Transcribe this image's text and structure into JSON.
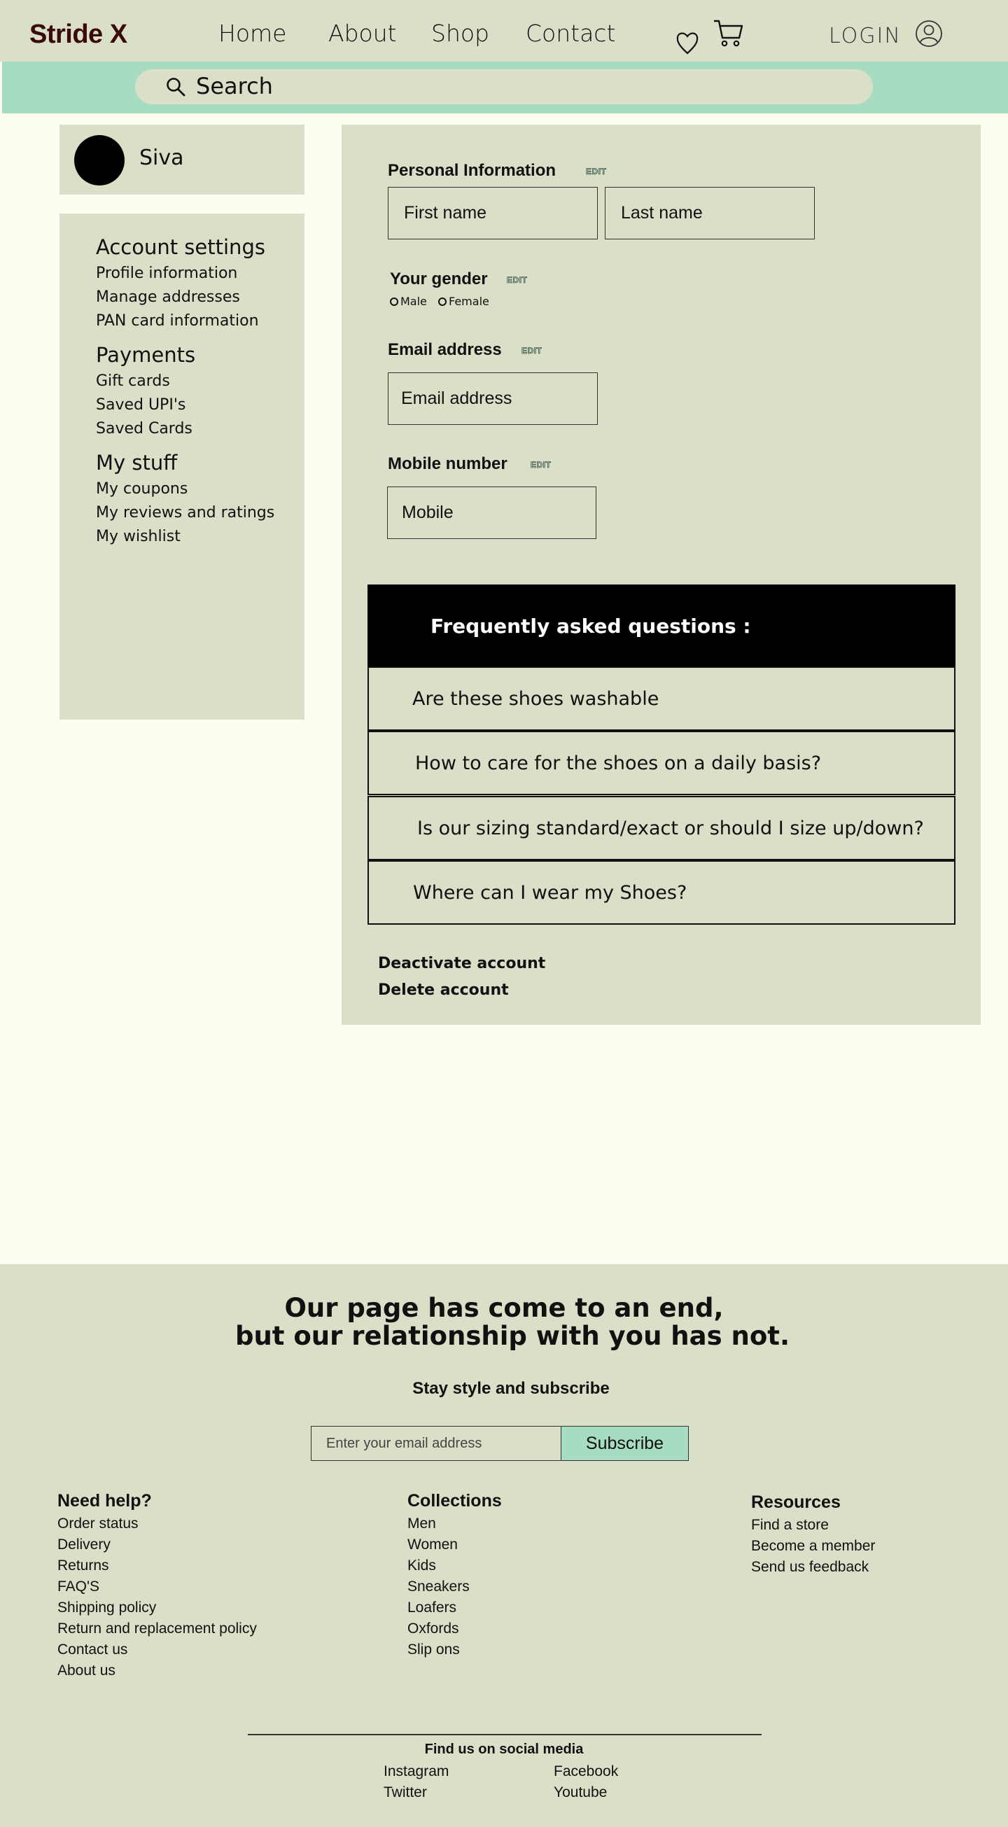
{
  "brand": "Stride X",
  "nav": [
    "Home",
    "About",
    "Shop",
    "Contact"
  ],
  "header": {
    "login_label": "LOGIN"
  },
  "search": {
    "label": "Search"
  },
  "profile": {
    "name": "Siva"
  },
  "sidebar": {
    "sections": [
      {
        "heading": "Account settings",
        "items": [
          "Profile information",
          "Manage addresses",
          "PAN card information"
        ]
      },
      {
        "heading": "Payments",
        "items": [
          "Gift cards",
          "Saved UPI's",
          "Saved Cards"
        ]
      },
      {
        "heading": "My stuff",
        "items": [
          "My coupons",
          "My reviews and ratings",
          "My wishlist"
        ]
      }
    ]
  },
  "form": {
    "personal_label": "Personal Information",
    "edit_label": "EDIT",
    "first_name": "First name",
    "last_name": "Last name",
    "gender_label": "Your gender",
    "gender_options": [
      "Male",
      "Female"
    ],
    "email_label": "Email address",
    "email_placeholder": "Email address",
    "mobile_label": "Mobile number",
    "mobile_placeholder": "Mobile"
  },
  "faq": {
    "title": "Frequently asked questions :",
    "items": [
      "Are these shoes washable",
      "How to care for the shoes on a daily basis?",
      "Is our sizing standard/exact or should I size up/down?",
      "Where can I wear my Shoes?"
    ]
  },
  "account_actions": [
    "Deactivate account",
    "Delete account"
  ],
  "footer": {
    "headline_1": "Our page has come to an end,",
    "headline_2": "but our relationship with you has not.",
    "subscribe_title": "Stay style and subscribe",
    "email_placeholder": "Enter your email address",
    "subscribe_label": "Subscribe",
    "columns": [
      {
        "heading": "Need help?",
        "items": [
          "Order status",
          "Delivery",
          "Returns",
          "FAQ'S",
          "Shipping policy",
          "Return and replacement policy",
          "Contact us",
          "About us"
        ]
      },
      {
        "heading": "Collections",
        "items": [
          "Men",
          "Women",
          "Kids",
          "Sneakers",
          "Loafers",
          "Oxfords",
          "Slip ons"
        ]
      },
      {
        "heading": "Resources",
        "items": [
          "Find a store",
          "Become a member",
          "Send us feedback"
        ]
      }
    ],
    "social_title": "Find us on social media",
    "social": [
      "Instagram",
      "Facebook",
      "Twitter",
      "Youtube"
    ]
  },
  "colors": {
    "page_bg": "#FEFDF1",
    "panel": "#DADFC8",
    "accent": "#A6DDC0",
    "brand": "#3A0A0A"
  }
}
